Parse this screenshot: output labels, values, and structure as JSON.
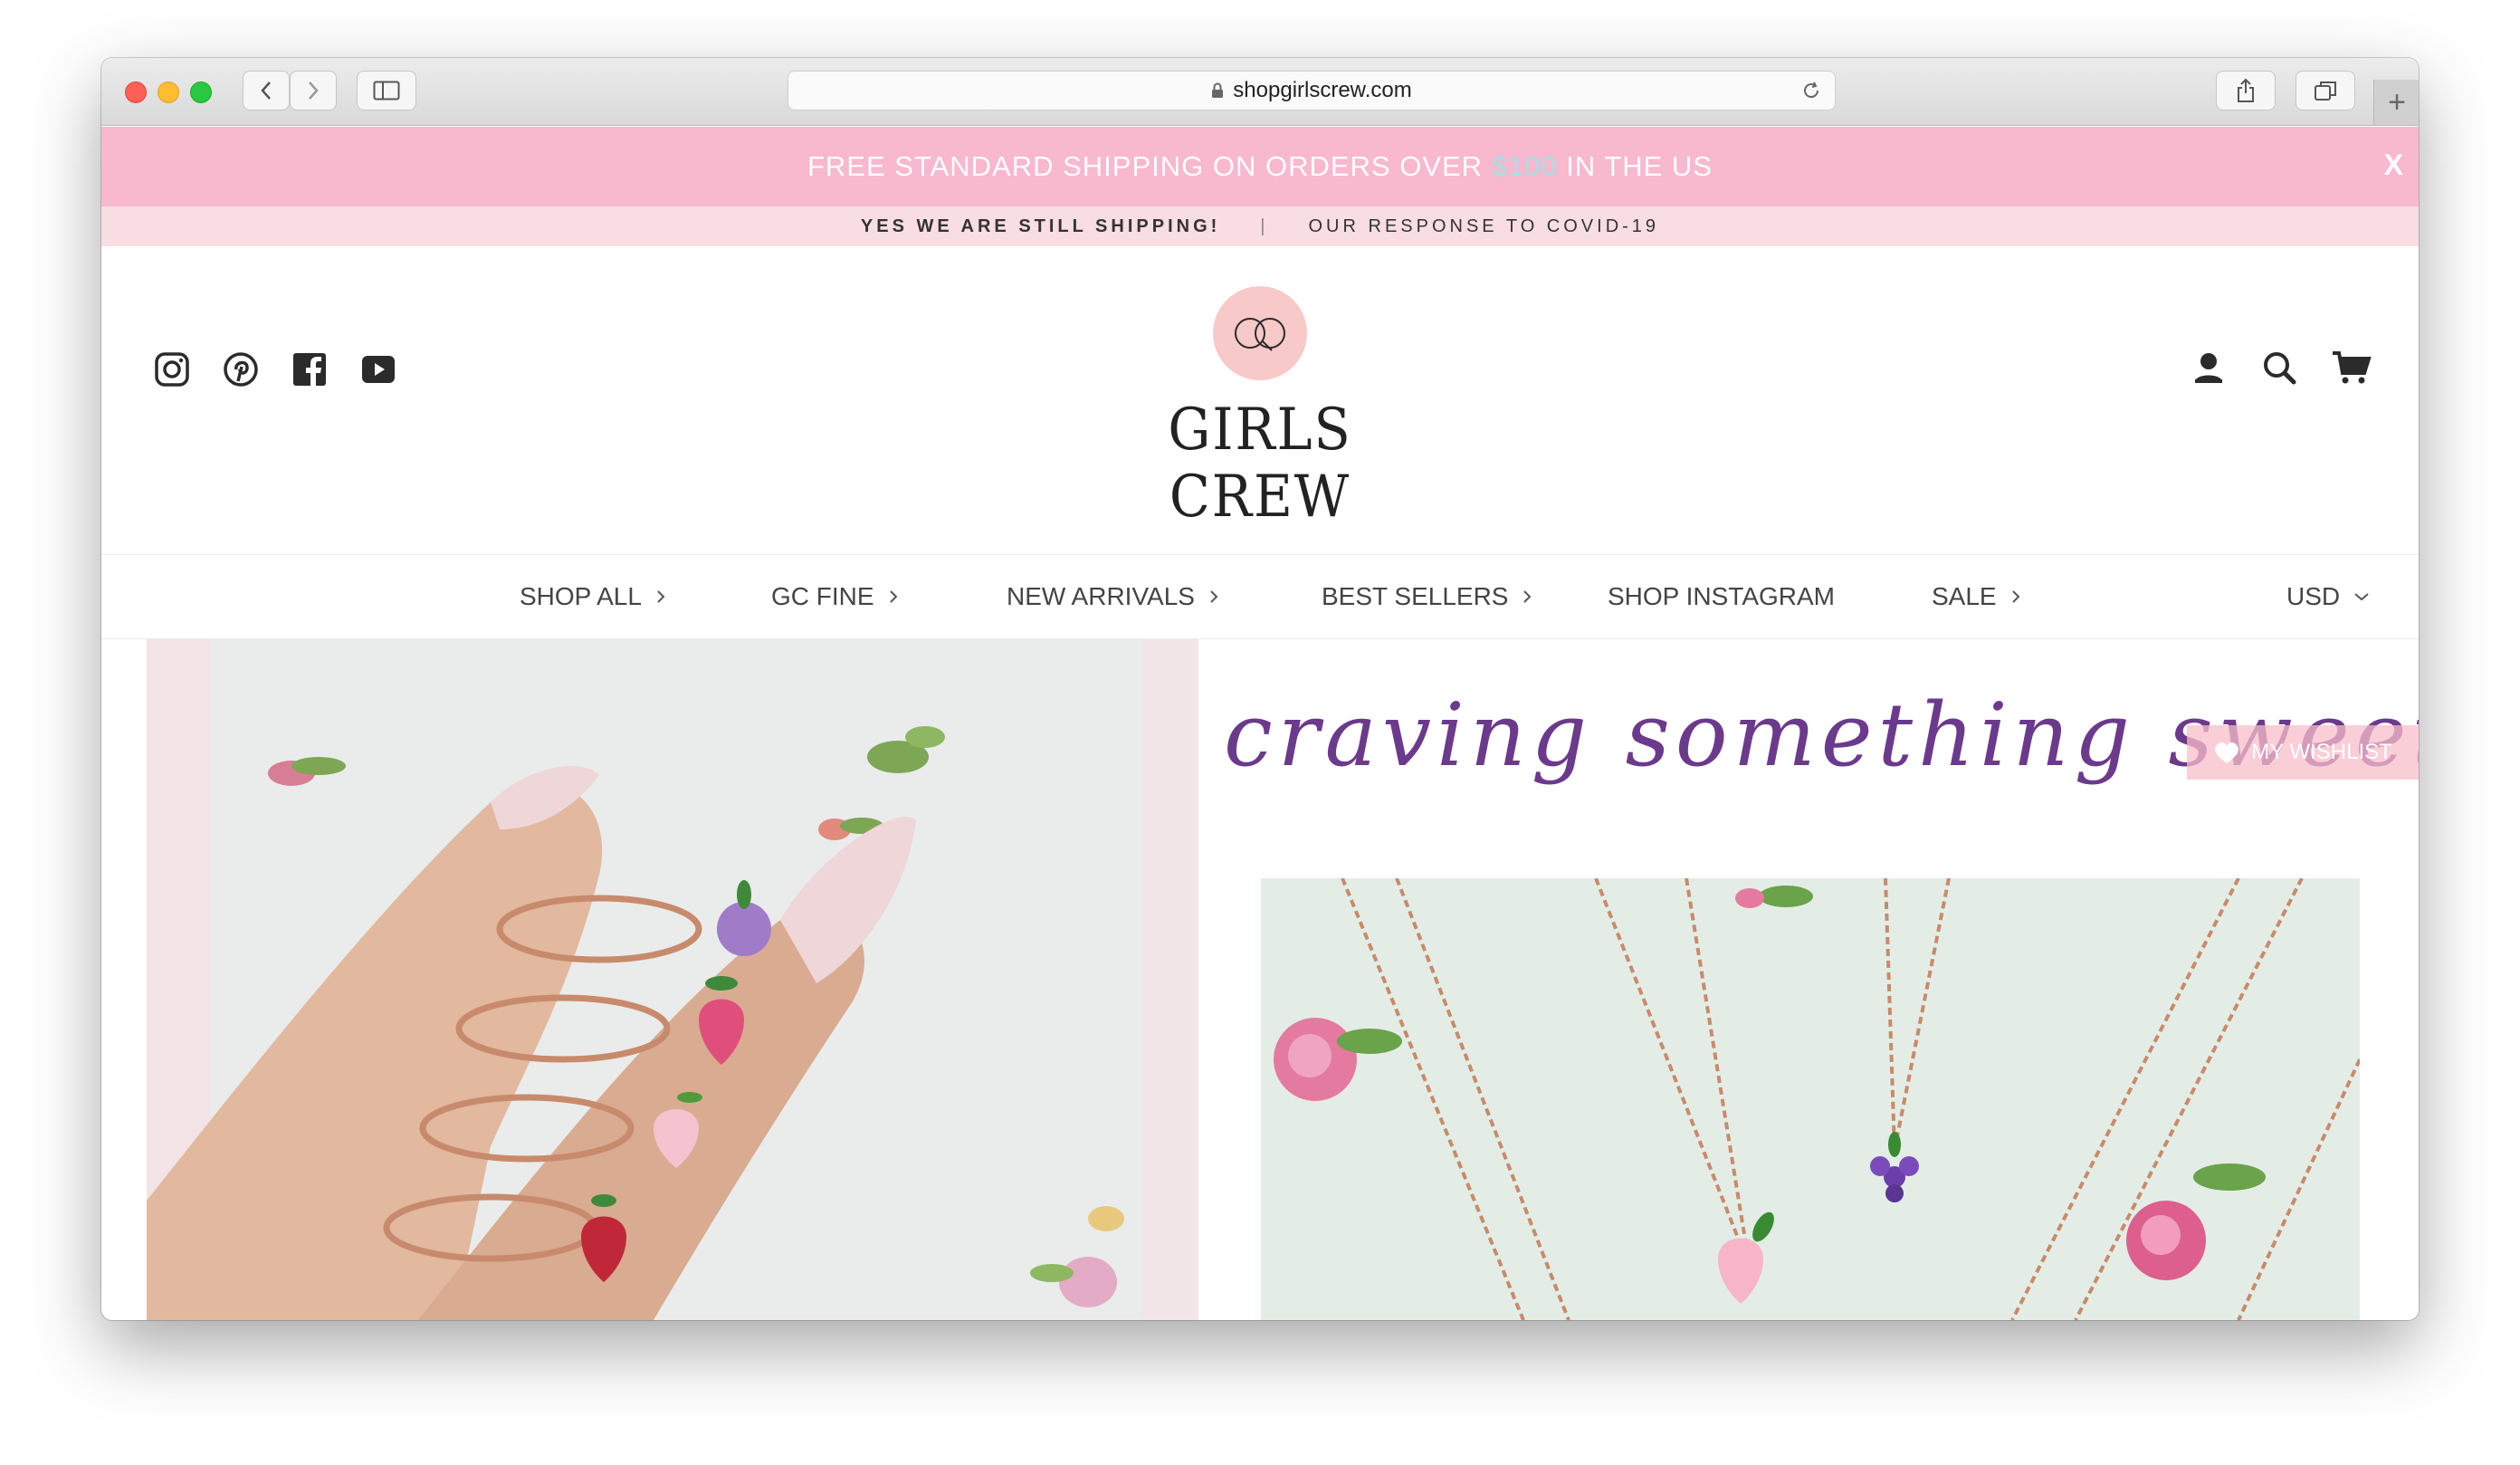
{
  "browser": {
    "url": "shopgirlscrew.com",
    "new_tab_symbol": "+"
  },
  "promo": {
    "text_before": "FREE STANDARD SHIPPING ON ORDERS OVER ",
    "accent": "$100",
    "text_after": " IN THE US",
    "close": "X"
  },
  "subpromo": {
    "left": "YES WE ARE STILL SHIPPING!",
    "separator": "|",
    "right": "OUR RESPONSE TO COVID-19"
  },
  "header": {
    "logo_text": "GIRLS CREW",
    "social_icons": [
      "instagram-icon",
      "pinterest-icon",
      "facebook-icon",
      "youtube-icon"
    ],
    "action_icons": [
      "account-icon",
      "search-icon",
      "cart-icon"
    ]
  },
  "nav": {
    "items": [
      {
        "label": "SHOP ALL"
      },
      {
        "label": "GC FINE"
      },
      {
        "label": "NEW ARRIVALS"
      },
      {
        "label": "BEST SELLERS"
      },
      {
        "label": "SHOP INSTAGRAM"
      },
      {
        "label": "SALE"
      }
    ],
    "currency": "USD"
  },
  "hero": {
    "headline": "craving something sweet?",
    "wishlist_label": "MY WISHLIST"
  },
  "colors": {
    "promo_bg": "#f8b8cd",
    "subpromo_bg": "#f8dde2",
    "accent": "#a8dfe6",
    "script": "#6b3a8c"
  }
}
